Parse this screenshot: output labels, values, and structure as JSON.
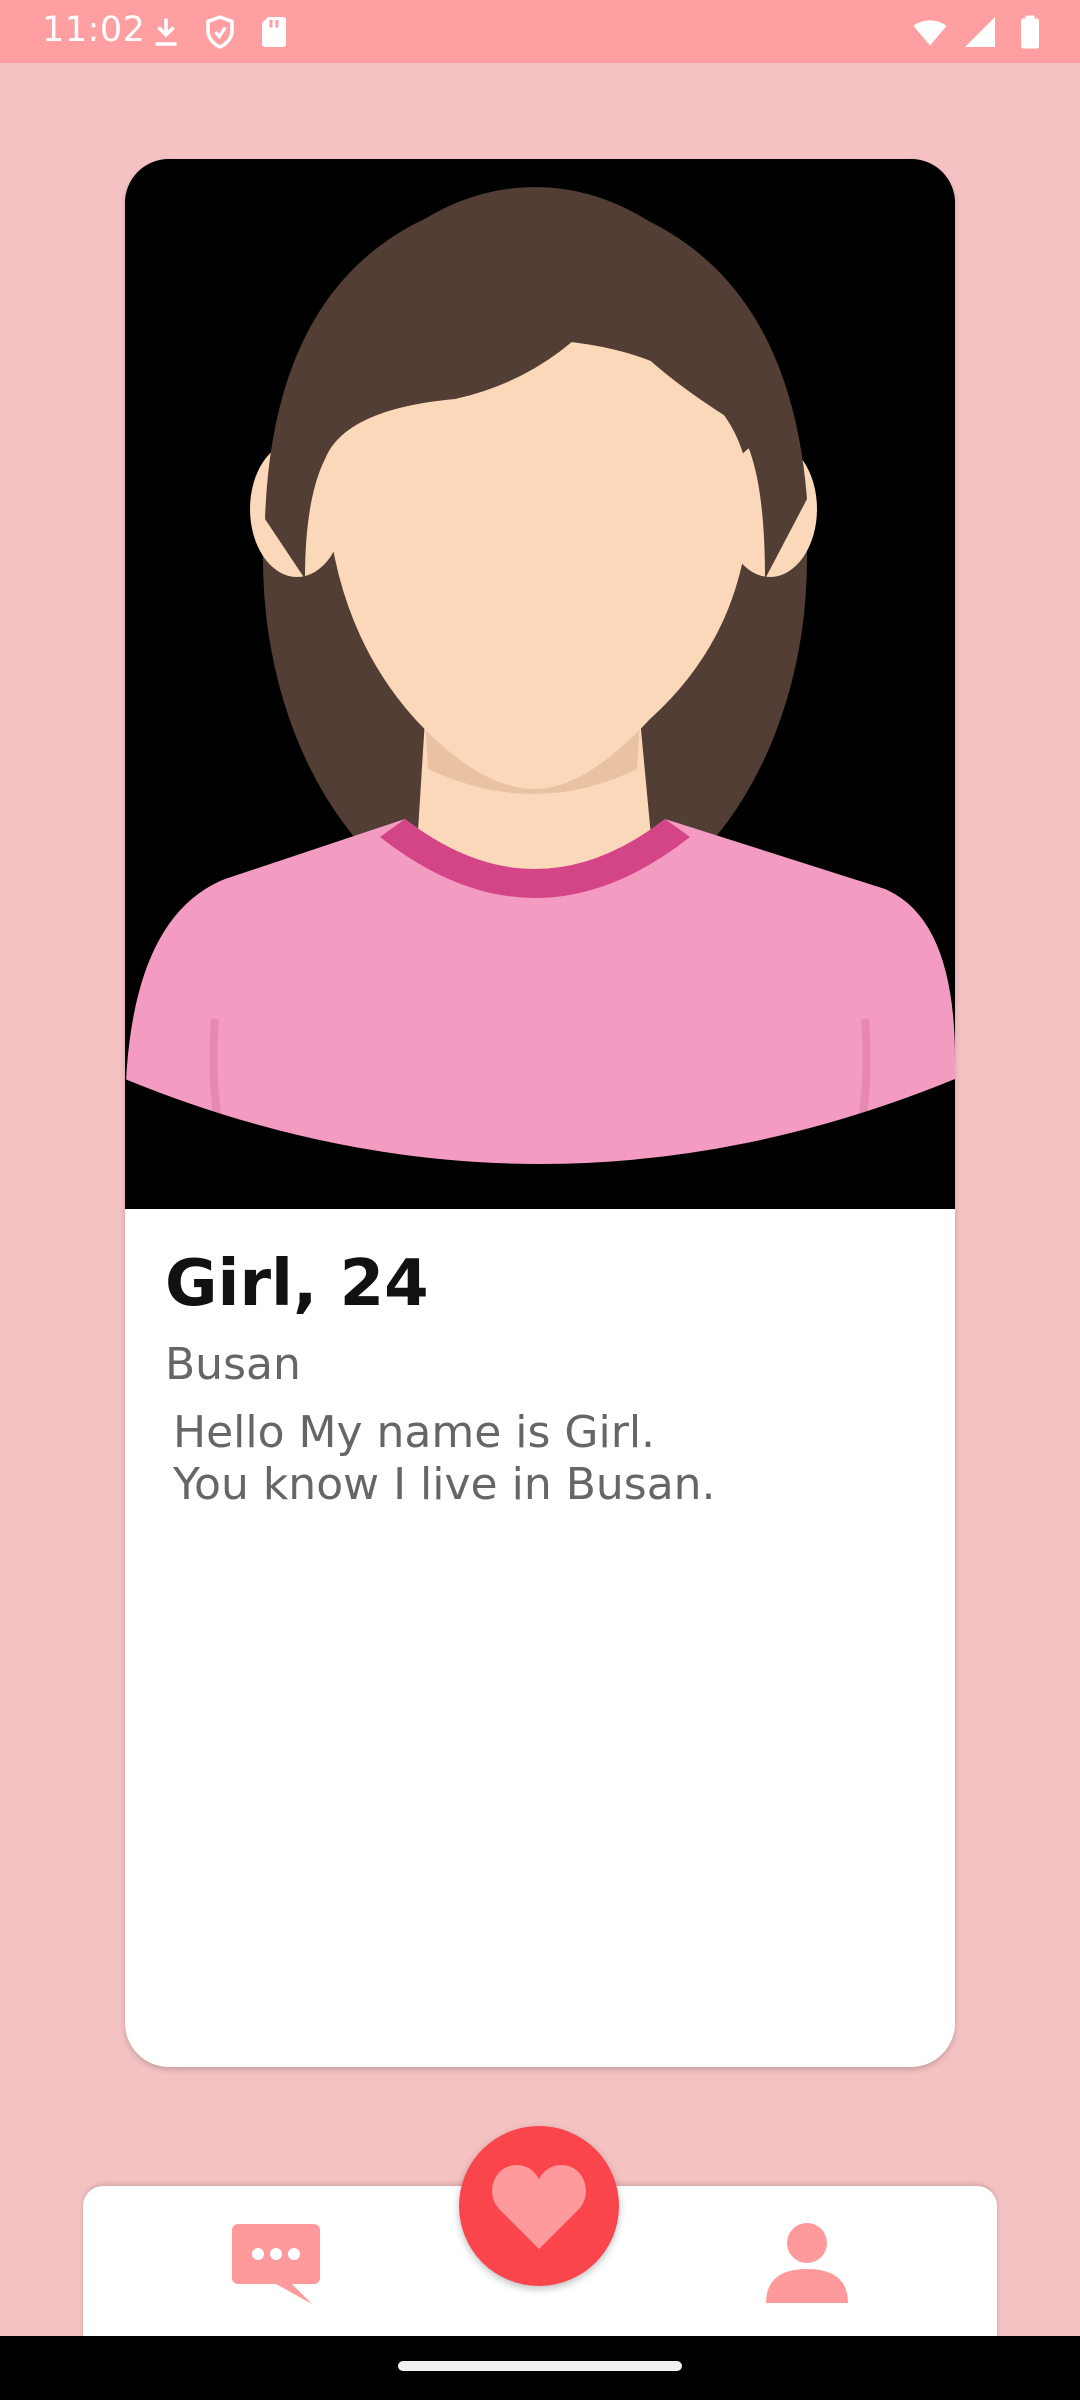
{
  "status_bar": {
    "time": "11:02",
    "left_icons": [
      "download-icon",
      "shield-icon",
      "sd-card-icon"
    ],
    "right_icons": [
      "wifi-icon",
      "cell-signal-icon",
      "battery-icon"
    ]
  },
  "profile": {
    "name_age": "Girl, 24",
    "location": "Busan",
    "bio_lines": [
      "Hello My name is Girl.",
      "You know I live in Busan."
    ]
  },
  "bottom_nav": {
    "items": [
      {
        "icon": "chat-icon"
      },
      {
        "icon": "heart-icon"
      },
      {
        "icon": "profile-icon"
      }
    ]
  },
  "colors": {
    "background": "#f5c2c3",
    "status_bar": "#ff9fa1",
    "accent": "#f9454b",
    "nav_icon": "#ff9a9c"
  }
}
